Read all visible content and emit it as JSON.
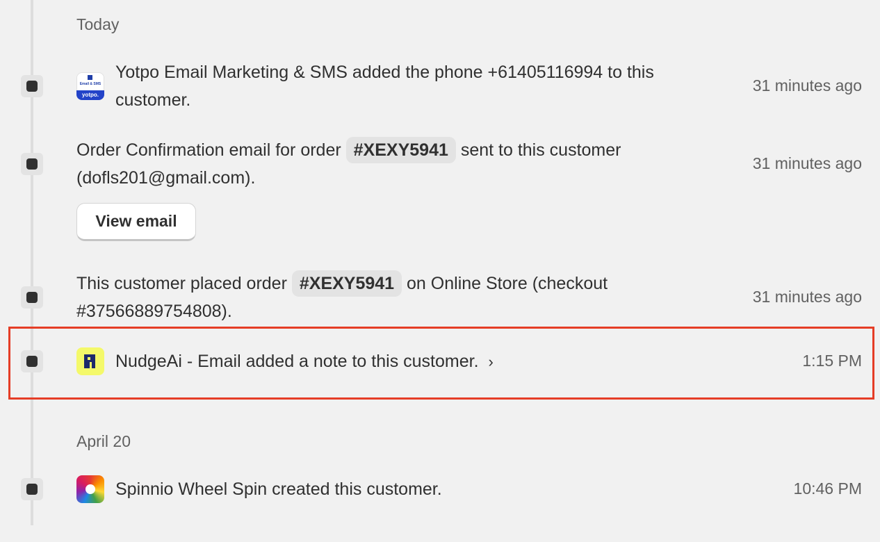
{
  "timeline": {
    "today_header": "Today",
    "april_header": "April 20",
    "events": [
      {
        "text": "Yotpo Email Marketing & SMS added the phone +61405116994 to this customer.",
        "time": "31 minutes ago",
        "icon": "yotpo-app-icon",
        "icon_label_small": "Email & SMS",
        "icon_label": "yotpo."
      },
      {
        "text_before": "Order Confirmation email for order",
        "order": "#XEXY5941",
        "text_after": "sent to this customer",
        "text_line2": "(dofls201@gmail.com).",
        "time": "31 minutes ago",
        "button_label": "View email"
      },
      {
        "text_before": "This customer placed order",
        "order": "#XEXY5941",
        "text_after": "on Online Store (checkout",
        "text_line2": "#37566889754808).",
        "time": "31 minutes ago"
      },
      {
        "text": "NudgeAi - Email added a note to this customer.",
        "time": "1:15 PM",
        "icon": "nudgeai-app-icon",
        "expandable": true
      },
      {
        "text": "Spinnio Wheel Spin created this customer.",
        "time": "10:46 PM",
        "icon": "spinnio-app-icon"
      }
    ]
  },
  "colors": {
    "background": "#f1f1f1",
    "timeline_dot": "#303030",
    "chip_background": "#e3e3e3",
    "highlight": "#e53d26",
    "nudge_yellow": "#f4f96a",
    "yotpo_blue": "#2343c8"
  }
}
